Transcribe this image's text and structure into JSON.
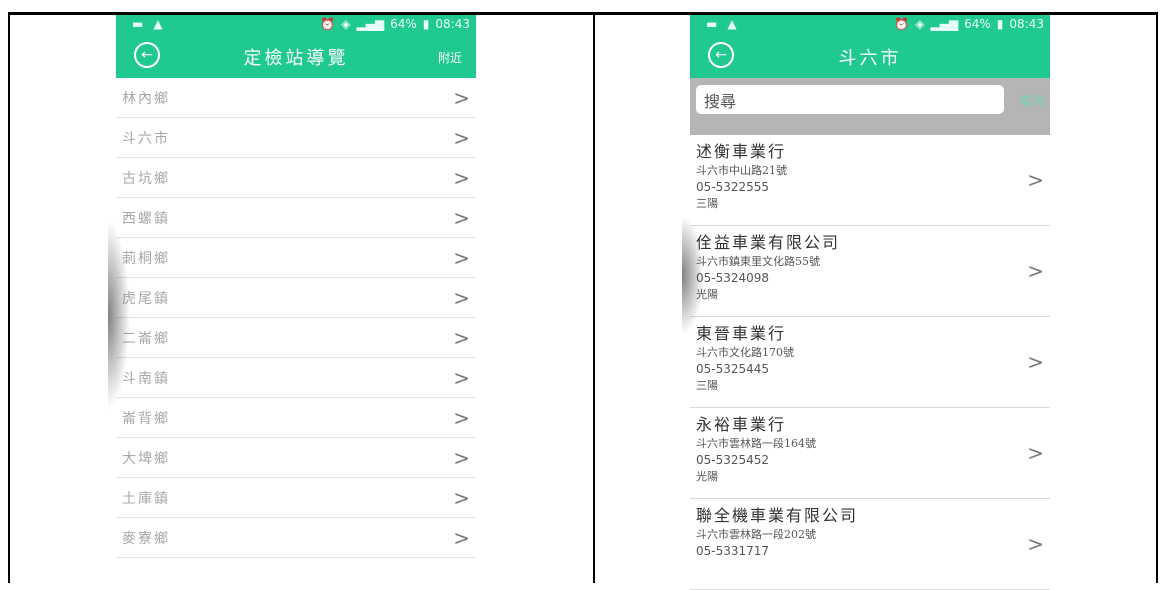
{
  "status_bar": {
    "battery": "64%",
    "time": "08:43"
  },
  "left": {
    "title": "定檢站導覽",
    "nearby": "附近",
    "items": [
      "林內鄉",
      "斗六市",
      "古坑鄉",
      "西螺鎮",
      "莿桐鄉",
      "虎尾鎮",
      "二崙鄉",
      "斗南鎮",
      "崙背鄉",
      "大埤鄉",
      "土庫鎮",
      "麥寮鄉"
    ]
  },
  "right": {
    "title": "斗六市",
    "search_placeholder": "搜尋",
    "cancel": "取消",
    "dealers": [
      {
        "name": "述衡車業行",
        "address": "斗六市中山路21號",
        "phone": "05-5322555",
        "brand": "三陽"
      },
      {
        "name": "佺益車業有限公司",
        "address": "斗六市鎮東里文化路55號",
        "phone": "05-5324098",
        "brand": "光陽"
      },
      {
        "name": "東晉車業行",
        "address": "斗六市文化路170號",
        "phone": "05-5325445",
        "brand": "三陽"
      },
      {
        "name": "永裕車業行",
        "address": "斗六市雲林路一段164號",
        "phone": "05-5325452",
        "brand": "光陽"
      },
      {
        "name": "聯全機車業有限公司",
        "address": "斗六市雲林路一段202號",
        "phone": "05-5331717",
        "brand": ""
      }
    ]
  },
  "icons": {
    "back": "back-arrow-icon",
    "chevron": "chevron-right-icon"
  },
  "colors": {
    "accent": "#20c98e",
    "search_bg": "#b5b5b5"
  }
}
